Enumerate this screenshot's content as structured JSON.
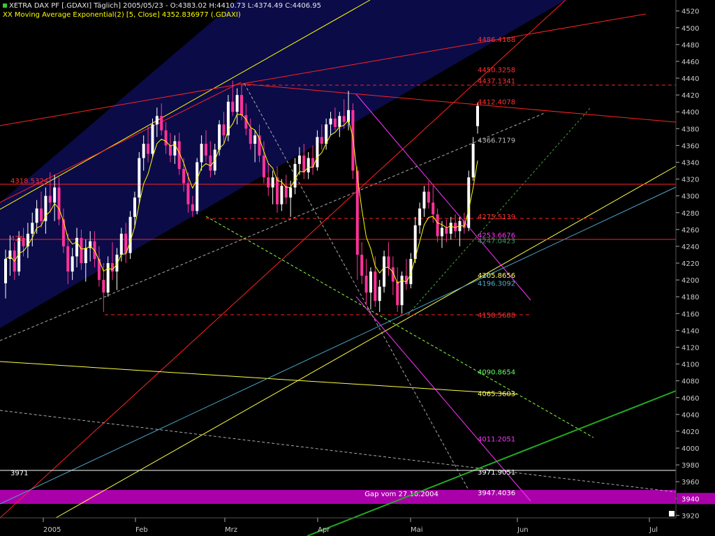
{
  "header": {
    "line1": "XETRA DAX PF [.GDAXI]  Täglich] 2005/05/23 - O:4383.02 H:4410.73 L:4374.49 C:4406.95",
    "line2": "XX Moving Average Exponential(2) [5, Close] 4352.836977 (.GDAXI)"
  },
  "colors": {
    "background": "#000000",
    "panel": "#0a0a44",
    "candle_up": "#ffffff",
    "candle_down": "#ff3399",
    "ema": "#ffff00",
    "gap_band": "#aa00aa"
  },
  "chart_data": {
    "type": "candlestick",
    "title": "XETRA DAX PF [.GDAXI]",
    "ylim": [
      3915,
      4530
    ],
    "yticks": [
      4520,
      4500,
      4480,
      4460,
      4440,
      4420,
      4400,
      4380,
      4360,
      4340,
      4320,
      4300,
      4280,
      4260,
      4240,
      4220,
      4200,
      4180,
      4160,
      4140,
      4120,
      4100,
      4080,
      4060,
      4040,
      4020,
      4000,
      3980,
      3960,
      3940,
      3920
    ],
    "y_highlight": "3940",
    "x_labels": [
      "2005",
      "Feb",
      "Mrz",
      "Apr",
      "Mai",
      "Jun",
      "Jul"
    ],
    "candles_approx": [
      {
        "o": 4196,
        "h": 4236,
        "l": 4178,
        "c": 4225
      },
      {
        "o": 4225,
        "h": 4253,
        "l": 4205,
        "c": 4235
      },
      {
        "o": 4235,
        "h": 4245,
        "l": 4200,
        "c": 4210
      },
      {
        "o": 4210,
        "h": 4258,
        "l": 4205,
        "c": 4250
      },
      {
        "o": 4250,
        "h": 4262,
        "l": 4228,
        "c": 4240
      },
      {
        "o": 4240,
        "h": 4268,
        "l": 4226,
        "c": 4255
      },
      {
        "o": 4255,
        "h": 4280,
        "l": 4240,
        "c": 4268
      },
      {
        "o": 4268,
        "h": 4295,
        "l": 4255,
        "c": 4285
      },
      {
        "o": 4285,
        "h": 4305,
        "l": 4262,
        "c": 4270
      },
      {
        "o": 4270,
        "h": 4310,
        "l": 4255,
        "c": 4300
      },
      {
        "o": 4300,
        "h": 4328,
        "l": 4280,
        "c": 4292
      },
      {
        "o": 4292,
        "h": 4325,
        "l": 4270,
        "c": 4310
      },
      {
        "o": 4310,
        "h": 4322,
        "l": 4265,
        "c": 4272
      },
      {
        "o": 4272,
        "h": 4285,
        "l": 4232,
        "c": 4240
      },
      {
        "o": 4240,
        "h": 4255,
        "l": 4195,
        "c": 4210
      },
      {
        "o": 4210,
        "h": 4238,
        "l": 4200,
        "c": 4228
      },
      {
        "o": 4228,
        "h": 4262,
        "l": 4215,
        "c": 4250
      },
      {
        "o": 4250,
        "h": 4260,
        "l": 4212,
        "c": 4220
      },
      {
        "o": 4220,
        "h": 4248,
        "l": 4198,
        "c": 4238
      },
      {
        "o": 4238,
        "h": 4258,
        "l": 4222,
        "c": 4246
      },
      {
        "o": 4246,
        "h": 4258,
        "l": 4215,
        "c": 4225
      },
      {
        "o": 4225,
        "h": 4240,
        "l": 4192,
        "c": 4200
      },
      {
        "o": 4200,
        "h": 4220,
        "l": 4162,
        "c": 4185
      },
      {
        "o": 4185,
        "h": 4228,
        "l": 4180,
        "c": 4220
      },
      {
        "o": 4220,
        "h": 4245,
        "l": 4200,
        "c": 4210
      },
      {
        "o": 4210,
        "h": 4238,
        "l": 4188,
        "c": 4230
      },
      {
        "o": 4230,
        "h": 4262,
        "l": 4222,
        "c": 4255
      },
      {
        "o": 4255,
        "h": 4268,
        "l": 4220,
        "c": 4232
      },
      {
        "o": 4232,
        "h": 4282,
        "l": 4225,
        "c": 4275
      },
      {
        "o": 4275,
        "h": 4305,
        "l": 4262,
        "c": 4298
      },
      {
        "o": 4298,
        "h": 4352,
        "l": 4290,
        "c": 4345
      },
      {
        "o": 4345,
        "h": 4372,
        "l": 4330,
        "c": 4362
      },
      {
        "o": 4362,
        "h": 4382,
        "l": 4340,
        "c": 4350
      },
      {
        "o": 4350,
        "h": 4392,
        "l": 4345,
        "c": 4385
      },
      {
        "o": 4385,
        "h": 4405,
        "l": 4370,
        "c": 4395
      },
      {
        "o": 4395,
        "h": 4410,
        "l": 4372,
        "c": 4378
      },
      {
        "o": 4378,
        "h": 4388,
        "l": 4350,
        "c": 4360
      },
      {
        "o": 4360,
        "h": 4375,
        "l": 4340,
        "c": 4348
      },
      {
        "o": 4348,
        "h": 4372,
        "l": 4338,
        "c": 4365
      },
      {
        "o": 4365,
        "h": 4375,
        "l": 4325,
        "c": 4332
      },
      {
        "o": 4332,
        "h": 4345,
        "l": 4305,
        "c": 4315
      },
      {
        "o": 4315,
        "h": 4328,
        "l": 4280,
        "c": 4290
      },
      {
        "o": 4290,
        "h": 4300,
        "l": 4275,
        "c": 4282
      },
      {
        "o": 4282,
        "h": 4345,
        "l": 4278,
        "c": 4340
      },
      {
        "o": 4340,
        "h": 4372,
        "l": 4330,
        "c": 4362
      },
      {
        "o": 4362,
        "h": 4378,
        "l": 4340,
        "c": 4348
      },
      {
        "o": 4348,
        "h": 4365,
        "l": 4322,
        "c": 4330
      },
      {
        "o": 4330,
        "h": 4362,
        "l": 4325,
        "c": 4355
      },
      {
        "o": 4355,
        "h": 4390,
        "l": 4348,
        "c": 4385
      },
      {
        "o": 4385,
        "h": 4400,
        "l": 4362,
        "c": 4372
      },
      {
        "o": 4372,
        "h": 4420,
        "l": 4365,
        "c": 4412
      },
      {
        "o": 4412,
        "h": 4437,
        "l": 4395,
        "c": 4400
      },
      {
        "o": 4400,
        "h": 4428,
        "l": 4385,
        "c": 4420
      },
      {
        "o": 4420,
        "h": 4432,
        "l": 4390,
        "c": 4396
      },
      {
        "o": 4396,
        "h": 4410,
        "l": 4372,
        "c": 4380
      },
      {
        "o": 4380,
        "h": 4392,
        "l": 4355,
        "c": 4362
      },
      {
        "o": 4362,
        "h": 4378,
        "l": 4340,
        "c": 4372
      },
      {
        "o": 4372,
        "h": 4385,
        "l": 4340,
        "c": 4348
      },
      {
        "o": 4348,
        "h": 4365,
        "l": 4315,
        "c": 4322
      },
      {
        "o": 4322,
        "h": 4338,
        "l": 4300,
        "c": 4310
      },
      {
        "o": 4310,
        "h": 4330,
        "l": 4290,
        "c": 4322
      },
      {
        "o": 4322,
        "h": 4335,
        "l": 4280,
        "c": 4290
      },
      {
        "o": 4290,
        "h": 4320,
        "l": 4282,
        "c": 4312
      },
      {
        "o": 4312,
        "h": 4325,
        "l": 4290,
        "c": 4298
      },
      {
        "o": 4298,
        "h": 4318,
        "l": 4275,
        "c": 4310
      },
      {
        "o": 4310,
        "h": 4345,
        "l": 4302,
        "c": 4338
      },
      {
        "o": 4338,
        "h": 4358,
        "l": 4325,
        "c": 4348
      },
      {
        "o": 4348,
        "h": 4362,
        "l": 4320,
        "c": 4328
      },
      {
        "o": 4328,
        "h": 4352,
        "l": 4320,
        "c": 4345
      },
      {
        "o": 4345,
        "h": 4360,
        "l": 4325,
        "c": 4334
      },
      {
        "o": 4334,
        "h": 4378,
        "l": 4330,
        "c": 4370
      },
      {
        "o": 4370,
        "h": 4385,
        "l": 4355,
        "c": 4362
      },
      {
        "o": 4362,
        "h": 4392,
        "l": 4355,
        "c": 4385
      },
      {
        "o": 4385,
        "h": 4400,
        "l": 4372,
        "c": 4392
      },
      {
        "o": 4392,
        "h": 4405,
        "l": 4378,
        "c": 4382
      },
      {
        "o": 4382,
        "h": 4400,
        "l": 4370,
        "c": 4395
      },
      {
        "o": 4395,
        "h": 4415,
        "l": 4380,
        "c": 4388
      },
      {
        "o": 4388,
        "h": 4425,
        "l": 4378,
        "c": 4402
      },
      {
        "o": 4402,
        "h": 4410,
        "l": 4320,
        "c": 4330
      },
      {
        "o": 4330,
        "h": 4335,
        "l": 4200,
        "c": 4230
      },
      {
        "o": 4230,
        "h": 4245,
        "l": 4195,
        "c": 4205
      },
      {
        "o": 4205,
        "h": 4225,
        "l": 4170,
        "c": 4185
      },
      {
        "o": 4185,
        "h": 4215,
        "l": 4165,
        "c": 4210
      },
      {
        "o": 4210,
        "h": 4228,
        "l": 4168,
        "c": 4175
      },
      {
        "o": 4175,
        "h": 4200,
        "l": 4162,
        "c": 4192
      },
      {
        "o": 4192,
        "h": 4235,
        "l": 4185,
        "c": 4228
      },
      {
        "o": 4228,
        "h": 4245,
        "l": 4205,
        "c": 4215
      },
      {
        "o": 4215,
        "h": 4228,
        "l": 4182,
        "c": 4198
      },
      {
        "o": 4198,
        "h": 4215,
        "l": 4162,
        "c": 4170
      },
      {
        "o": 4170,
        "h": 4210,
        "l": 4160,
        "c": 4205
      },
      {
        "o": 4205,
        "h": 4225,
        "l": 4188,
        "c": 4195
      },
      {
        "o": 4195,
        "h": 4232,
        "l": 4190,
        "c": 4225
      },
      {
        "o": 4225,
        "h": 4275,
        "l": 4220,
        "c": 4265
      },
      {
        "o": 4265,
        "h": 4292,
        "l": 4255,
        "c": 4285
      },
      {
        "o": 4285,
        "h": 4312,
        "l": 4275,
        "c": 4305
      },
      {
        "o": 4305,
        "h": 4318,
        "l": 4285,
        "c": 4292
      },
      {
        "o": 4292,
        "h": 4312,
        "l": 4268,
        "c": 4278
      },
      {
        "o": 4278,
        "h": 4285,
        "l": 4245,
        "c": 4252
      },
      {
        "o": 4252,
        "h": 4270,
        "l": 4238,
        "c": 4262
      },
      {
        "o": 4262,
        "h": 4272,
        "l": 4245,
        "c": 4255
      },
      {
        "o": 4255,
        "h": 4275,
        "l": 4248,
        "c": 4268
      },
      {
        "o": 4268,
        "h": 4278,
        "l": 4250,
        "c": 4258
      },
      {
        "o": 4258,
        "h": 4275,
        "l": 4240,
        "c": 4270
      },
      {
        "o": 4270,
        "h": 4280,
        "l": 4255,
        "c": 4262
      },
      {
        "o": 4262,
        "h": 4330,
        "l": 4258,
        "c": 4322
      },
      {
        "o": 4322,
        "h": 4370,
        "l": 4318,
        "c": 4362
      },
      {
        "o": 4383,
        "h": 4411,
        "l": 4374,
        "c": 4407
      }
    ],
    "horizontal_levels": [
      {
        "value": 4486.4188,
        "label": "4486.4188",
        "color": "#ff3333",
        "dashed": false
      },
      {
        "value": 4450.3258,
        "label": "4450.3258",
        "color": "#ff3333",
        "dashed": false
      },
      {
        "value": 4437.1341,
        "label": "4437.1341",
        "color": "#ff3333",
        "dashed": true
      },
      {
        "value": 4412.4078,
        "label": "4412.4078",
        "color": "#ff3333",
        "dashed": false
      },
      {
        "value": 4366.7179,
        "label": "4366.7179",
        "color": "#bbbbbb",
        "dashed": false
      },
      {
        "value": 4318.5324,
        "label": "4318.5324",
        "color": "#ff3333",
        "dashed": false
      },
      {
        "value": 4275.5139,
        "label": "4275.5139",
        "color": "#ff3333",
        "dashed": true
      },
      {
        "value": 4253.6676,
        "label": "4253.6676",
        "color": "#ff33ff",
        "dashed": false
      },
      {
        "value": 4250,
        "label": "425",
        "color": "#ff3333",
        "dashed": false
      },
      {
        "value": 4247.0423,
        "label": "4247.0423",
        "color": "#339966",
        "dashed": false
      },
      {
        "value": 4205.8656,
        "label": "4205.8656",
        "color": "#ffff66",
        "dashed": false
      },
      {
        "value": 4196.3092,
        "label": "4196.3092",
        "color": "#55aacc",
        "dashed": false
      },
      {
        "value": 4158.5688,
        "label": "4158.5688",
        "color": "#ff3333",
        "dashed": true
      },
      {
        "value": 4090.8654,
        "label": "4090.8654",
        "color": "#66ff66",
        "dashed": false
      },
      {
        "value": 4065.3603,
        "label": "4065.3603",
        "color": "#ffff66",
        "dashed": false
      },
      {
        "value": 4011.2051,
        "label": "4011.2051",
        "color": "#ff33ff",
        "dashed": false
      },
      {
        "value": 3971.9051,
        "label": "3971.9051",
        "color": "#ffffff",
        "dashed": false
      },
      {
        "value": 3947.4036,
        "label": "3947.4036",
        "color": "#ffffff",
        "dashed": false
      },
      {
        "value": 3971,
        "label": "3971",
        "color": "#ffffff",
        "dashed": false
      }
    ],
    "annotation": "Gap vom 27.10.2004"
  }
}
